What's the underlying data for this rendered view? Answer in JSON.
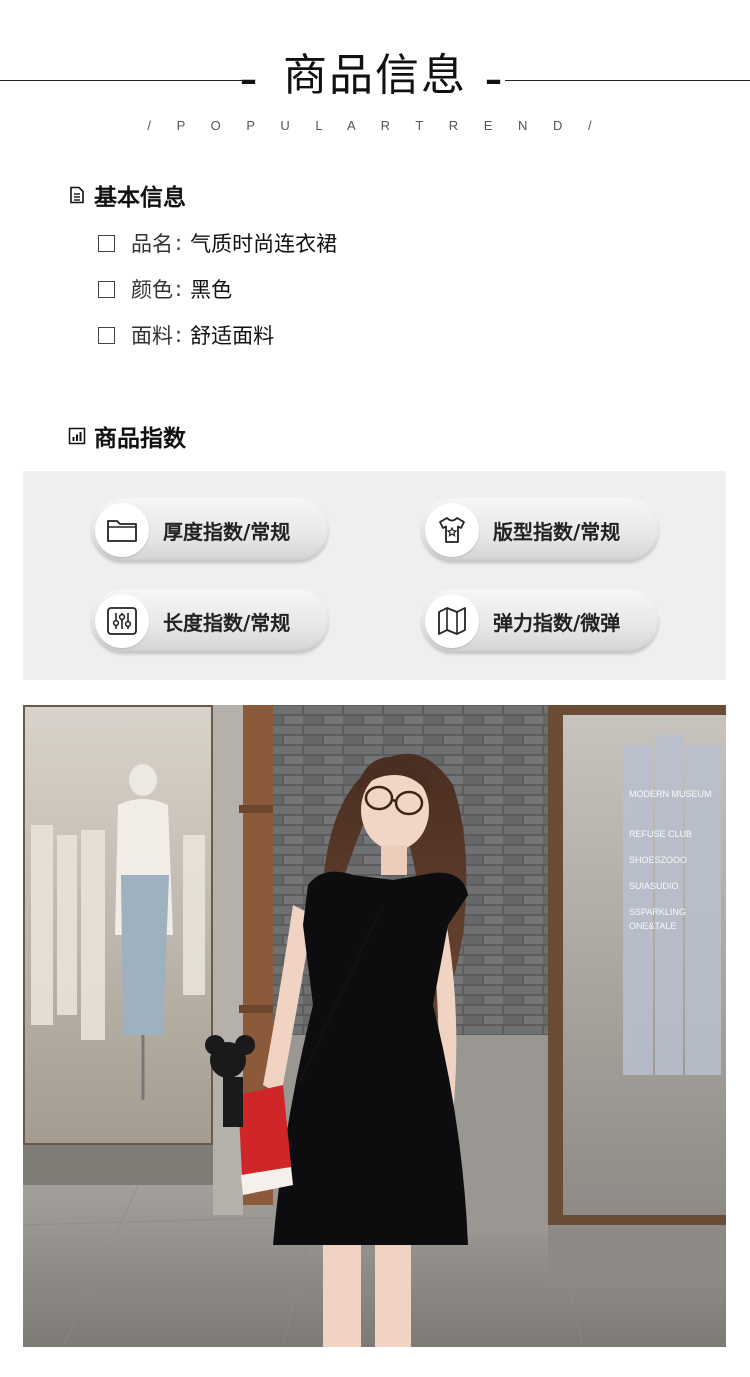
{
  "header": {
    "title": "商品信息",
    "subtitle": "/ P O P U L A R   T R E N D /"
  },
  "basic_info": {
    "heading": "基本信息",
    "items": [
      {
        "label": "品名",
        "sep": ":",
        "value": "气质时尚连衣裙"
      },
      {
        "label": "颜色",
        "sep": ":",
        "value": "黑色"
      },
      {
        "label": "面料",
        "sep": ":",
        "value": "舒适面料"
      }
    ]
  },
  "product_index": {
    "heading": "商品指数",
    "pills": [
      {
        "label": "厚度指数/常规",
        "icon": "folder-icon"
      },
      {
        "label": "版型指数/常规",
        "icon": "tshirt-icon"
      },
      {
        "label": "长度指数/常规",
        "icon": "sliders-icon"
      },
      {
        "label": "弹力指数/微弹",
        "icon": "map-icon"
      }
    ]
  },
  "photo": {
    "subject": "model-in-black-dress-photo",
    "store_sign_lines": [
      "MODERN MUSEUM",
      "REFUSE CLUB",
      "SHOESZOOO",
      "SUIASUDIO",
      "SSPARKLING",
      "ONE&TALE"
    ]
  },
  "colors": {
    "text": "#1a1a1a",
    "panel_bg": "#efefef",
    "dress": "#0d0d10",
    "bag": "#d0262a"
  }
}
